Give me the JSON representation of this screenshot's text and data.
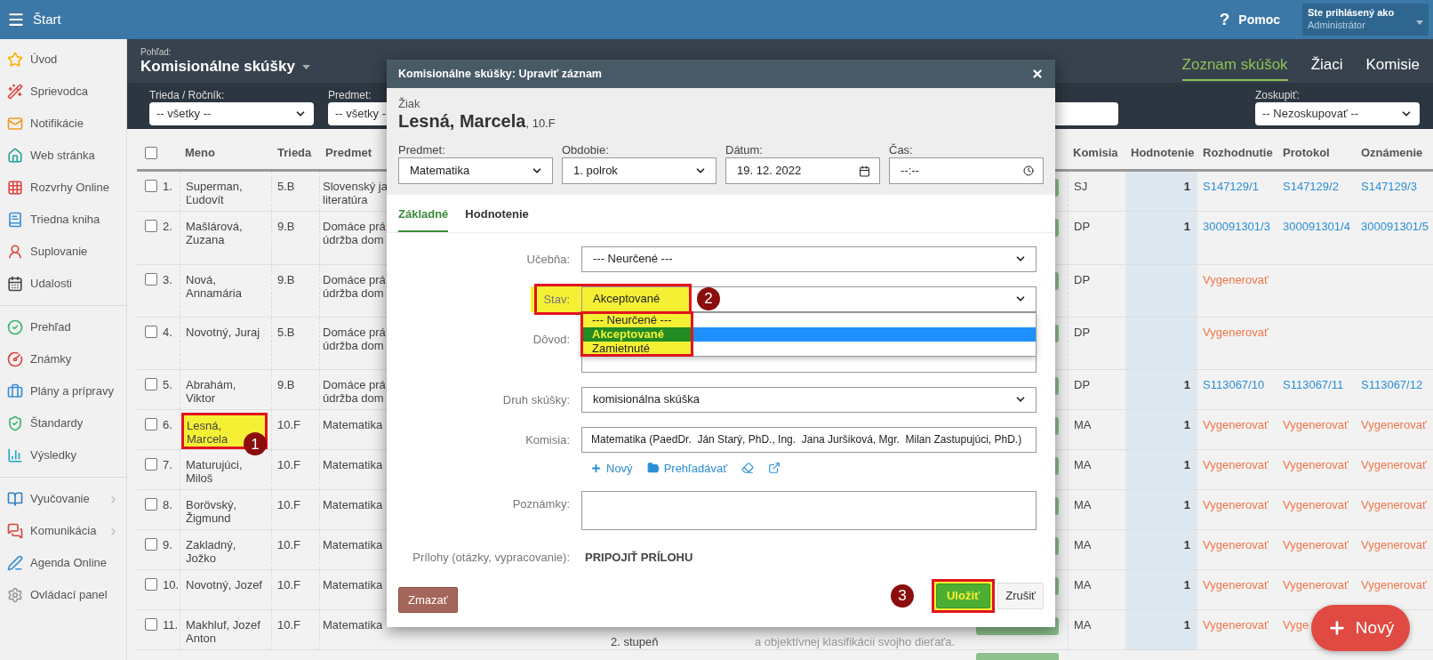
{
  "topbar": {
    "menu": "Štart",
    "help_icon": "?",
    "help": "Pomoc",
    "user_caption": "Ste prihlásený ako",
    "user_name": "Administrátor"
  },
  "sidebar": {
    "sections": [
      {
        "items": [
          {
            "label": "Úvod",
            "has_submenu": false
          },
          {
            "label": "Sprievodca",
            "has_submenu": false
          },
          {
            "label": "Notifikácie",
            "has_submenu": false
          },
          {
            "label": "Web stránka",
            "has_submenu": false
          },
          {
            "label": "Rozvrhy Online",
            "has_submenu": false
          },
          {
            "label": "Triedna kniha",
            "has_submenu": false
          },
          {
            "label": "Suplovanie",
            "has_submenu": false
          },
          {
            "label": "Udalosti",
            "has_submenu": false
          }
        ]
      },
      {
        "items": [
          {
            "label": "Prehľad",
            "has_submenu": false
          },
          {
            "label": "Známky",
            "has_submenu": false
          },
          {
            "label": "Plány a prípravy",
            "has_submenu": false
          },
          {
            "label": "Štandardy",
            "has_submenu": false
          },
          {
            "label": "Výsledky",
            "has_submenu": false
          }
        ]
      },
      {
        "items": [
          {
            "label": "Vyučovanie",
            "has_submenu": true
          },
          {
            "label": "Komunikácia",
            "has_submenu": true
          },
          {
            "label": "Agenda Online",
            "has_submenu": false
          },
          {
            "label": "Ovládací panel",
            "has_submenu": false
          }
        ]
      }
    ]
  },
  "view": {
    "caption": "Pohľad:",
    "title": "Komisionálne skúšky",
    "tabs": [
      {
        "label": "Zoznam skúšok",
        "selected": true
      },
      {
        "label": "Žiaci",
        "selected": false
      },
      {
        "label": "Komisie",
        "selected": false
      }
    ],
    "filters": [
      {
        "label": "Trieda / Ročník:",
        "value": "-- všetky --"
      },
      {
        "label": "Predmet:",
        "value": "-- všetky -"
      }
    ],
    "group": {
      "label": "Zoskupiť:",
      "value": "-- Nezoskupovať --"
    }
  },
  "table": {
    "all_checked": false,
    "columns": {
      "name": "Meno",
      "class": "Trieda",
      "subject": "Predmet",
      "commission": "Komisia",
      "grade": "Hodnotenie",
      "decision": "Rozhodnutie",
      "protocol": "Protokol",
      "notice": "Oznámenie"
    },
    "rows": [
      {
        "number": "1.",
        "checked": false,
        "highlighted": false,
        "name": "Superman, Ľudovít",
        "class": "5.B",
        "subject": [
          "Slovenský ja",
          "literatúra"
        ],
        "commission": "SJ",
        "grade": "1",
        "docs": [
          {
            "text": "S147129/1",
            "kind": "link"
          },
          {
            "text": "S147129/2",
            "kind": "link"
          },
          {
            "text": "S147129/3",
            "kind": "link"
          }
        ]
      },
      {
        "number": "2.",
        "checked": false,
        "highlighted": false,
        "name": "Mašlárová, Zuzana",
        "class": "9.B",
        "subject": [
          "Domáce prá",
          "údržba dom"
        ],
        "commission": "DP",
        "grade": "1",
        "docs": [
          {
            "text": "300091301/3",
            "kind": "link"
          },
          {
            "text": "300091301/4",
            "kind": "link"
          },
          {
            "text": "300091301/5",
            "kind": "link"
          }
        ]
      },
      {
        "number": "3.",
        "checked": false,
        "highlighted": false,
        "name": "Nová, Annamária",
        "class": "9.B",
        "subject": [
          "Domáce prá",
          "údržba dom"
        ],
        "commission": "DP",
        "docs": [
          {
            "text": "Vygenerovať",
            "kind": "generate"
          }
        ]
      },
      {
        "number": "4.",
        "checked": false,
        "highlighted": false,
        "name": "Novotný, Juraj",
        "class": "5.B",
        "subject": [
          "Domáce prá",
          "údržba dom"
        ],
        "commission": "DP",
        "docs": [
          {
            "text": "Vygenerovať",
            "kind": "generate"
          }
        ]
      },
      {
        "number": "5.",
        "checked": false,
        "highlighted": false,
        "name": "Abrahám, Viktor",
        "class": "9.B",
        "subject": [
          "Domáce prá",
          "údržba dom"
        ],
        "commission": "DP",
        "grade": "1",
        "docs": [
          {
            "text": "S113067/10",
            "kind": "link"
          },
          {
            "text": "S113067/11",
            "kind": "link"
          },
          {
            "text": "S113067/12",
            "kind": "link"
          }
        ]
      },
      {
        "number": "6.",
        "checked": false,
        "highlighted": true,
        "marker": "1",
        "name": "Lesná, Marcela",
        "class": "10.F",
        "subject": [
          "Matematika"
        ],
        "commission": "MA",
        "grade": "1",
        "docs": [
          {
            "text": "Vygenerovať",
            "kind": "generate"
          },
          {
            "text": "Vygenerovať",
            "kind": "generate"
          },
          {
            "text": "Vygenerovať",
            "kind": "generate"
          }
        ]
      },
      {
        "number": "7.",
        "checked": false,
        "highlighted": false,
        "name": "Maturujúci, Miloš",
        "class": "10.F",
        "subject": [
          "Matematika"
        ],
        "commission": "MA",
        "grade": "1",
        "docs": [
          {
            "text": "Vygenerovať",
            "kind": "generate"
          },
          {
            "text": "Vygenerovať",
            "kind": "generate"
          },
          {
            "text": "Vygenerovať",
            "kind": "generate"
          }
        ]
      },
      {
        "number": "8.",
        "checked": false,
        "highlighted": false,
        "name": "Borövský, Žigmund",
        "class": "10.F",
        "subject": [
          "Matematika"
        ],
        "commission": "MA",
        "grade": "1",
        "docs": [
          {
            "text": "Vygenerovať",
            "kind": "generate"
          },
          {
            "text": "Vygenerovať",
            "kind": "generate"
          },
          {
            "text": "Vygenerovať",
            "kind": "generate"
          }
        ]
      },
      {
        "number": "9.",
        "checked": false,
        "highlighted": false,
        "name": "Zakladný, Jožko",
        "class": "10.F",
        "subject": [
          "Matematika"
        ],
        "commission": "MA",
        "grade": "1",
        "docs": [
          {
            "text": "Vygenerovať",
            "kind": "generate"
          },
          {
            "text": "Vygenerovať",
            "kind": "generate"
          },
          {
            "text": "Vygenerovať",
            "kind": "generate"
          }
        ]
      },
      {
        "number": "10.",
        "checked": false,
        "highlighted": false,
        "name": "Novotný, Jozef",
        "class": "10.F",
        "subject": [
          "Matematika"
        ],
        "commission": "MA",
        "grade": "1",
        "docs": [
          {
            "text": "Vygenerovať",
            "kind": "generate"
          },
          {
            "text": "Vygenerovať",
            "kind": "generate"
          },
          {
            "text": "Vygenerovať",
            "kind": "generate"
          }
        ]
      },
      {
        "number": "11.",
        "checked": false,
        "highlighted": false,
        "name": "Makhluf, Jozef Anton",
        "class": "10.F",
        "subject": [
          "Matematika"
        ],
        "level": "2. stupeň",
        "note": "a objektívnej klasifikácii svojho dieťaťa.",
        "commission": "MA",
        "grade": "1",
        "docs": [
          {
            "text": "Vygenerovať",
            "kind": "generate"
          },
          {
            "text": "Vyge",
            "kind": "generate"
          }
        ]
      }
    ]
  },
  "fab": {
    "label": "Nový"
  },
  "modal": {
    "title": "Komisionálne skúšky: Upraviť záznam",
    "student_caption": "Žiak",
    "student_name": "Lesná, Marcela",
    "student_class": ", 10.F",
    "fields": [
      {
        "label": "Predmet:",
        "value": "Matematika",
        "kind": "select"
      },
      {
        "label": "Obdobie:",
        "value": "1. polrok",
        "kind": "select"
      },
      {
        "label": "Dátum:",
        "value": "19. 12. 2022",
        "kind": "date"
      },
      {
        "label": "Čas:",
        "value": "--:--",
        "kind": "time"
      }
    ],
    "tabs": [
      {
        "label": "Základné",
        "selected": true
      },
      {
        "label": "Hodnotenie",
        "selected": false
      }
    ],
    "rows": [
      {
        "label": "Učebňa:",
        "kind": "select",
        "value": "--- Neurčené ---",
        "highlighted": false
      },
      {
        "label": "Stav:",
        "kind": "select",
        "value": "Akceptované",
        "highlighted": true,
        "marker": "2",
        "options": [
          {
            "label": "--- Neurčené ---",
            "selected": false
          },
          {
            "label": "Akceptované",
            "selected": true
          },
          {
            "label": "Zamietnuté",
            "selected": false
          }
        ]
      },
      {
        "label": "Dôvod:",
        "kind": "textarea",
        "highlighted": false
      },
      {
        "label": "Druh skúšky:",
        "kind": "select",
        "value": "komisionálna skúška",
        "highlighted": false
      },
      {
        "label": "Komisia:",
        "kind": "text",
        "value": "Matematika (PaedDr.  Ján Starý, PhD., Ing.  Jana Juršiková, Mgr.  Milan Zastupujúci, PhD.)",
        "highlighted": false,
        "actions": [
          {
            "label": "Nový",
            "kind": "new"
          },
          {
            "label": "Prehľadávať",
            "kind": "browse"
          }
        ]
      },
      {
        "label": "Poznámky:",
        "kind": "textarea",
        "highlighted": false
      },
      {
        "label": "Prílohy (otázky, vypracovanie):",
        "kind": "attach",
        "value": "PRIPOJIŤ PRÍLOHU",
        "highlighted": false
      }
    ],
    "delete": "Zmazať",
    "save": {
      "label": "Uložiť",
      "highlighted": true,
      "marker": "3"
    },
    "cancel": "Zrušiť"
  }
}
